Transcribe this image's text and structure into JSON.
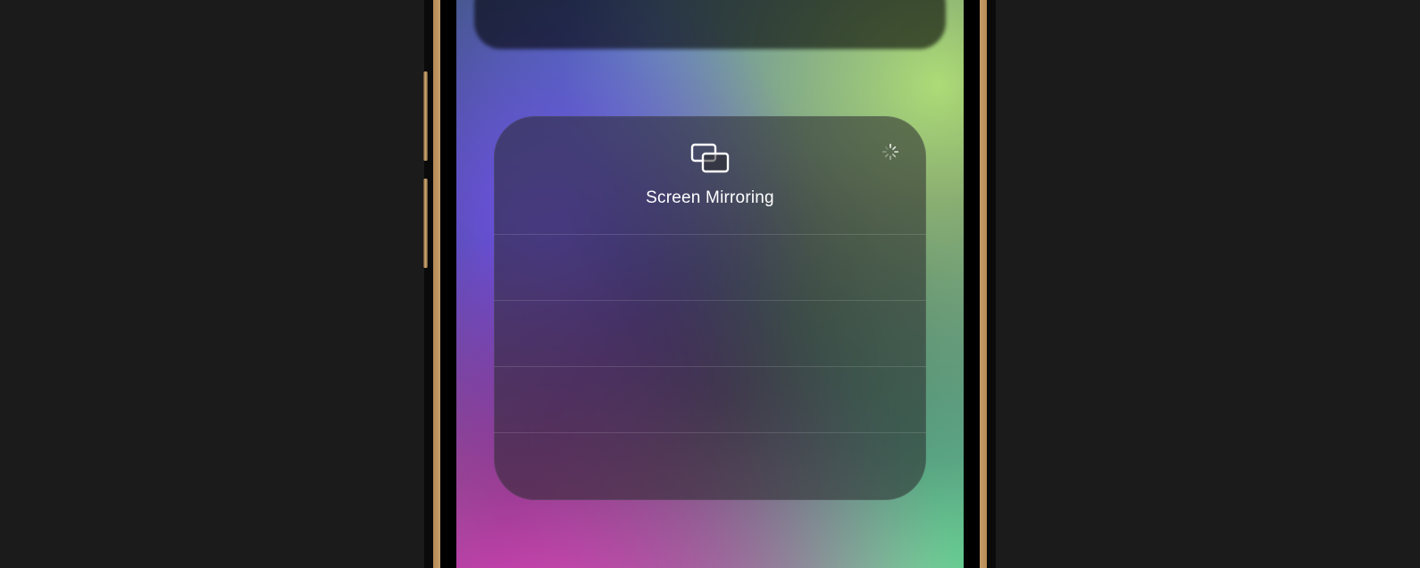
{
  "panel": {
    "title": "Screen Mirroring"
  }
}
